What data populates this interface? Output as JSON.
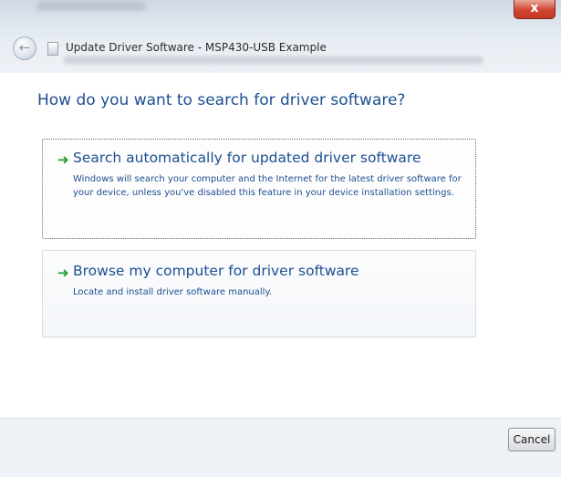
{
  "window": {
    "title": "Update Driver Software - MSP430-USB Example",
    "close_label": "x"
  },
  "icons": {
    "back": "back-arrow-icon",
    "dialog": "device-icon",
    "option_arrow": "green-arrow-icon"
  },
  "main": {
    "question": "How do you want to search for driver software?",
    "options": [
      {
        "title": "Search automatically for updated driver software",
        "description": "Windows will search your computer and the Internet for the latest driver software for your device, unless you've disabled this feature in your device installation settings."
      },
      {
        "title": "Browse my computer for driver software",
        "description": "Locate and install driver software manually."
      }
    ]
  },
  "footer": {
    "cancel_label": "Cancel"
  },
  "colors": {
    "accent_text": "#1d4f91",
    "arrow": "#1f9a2d",
    "close": "#c23a24"
  }
}
